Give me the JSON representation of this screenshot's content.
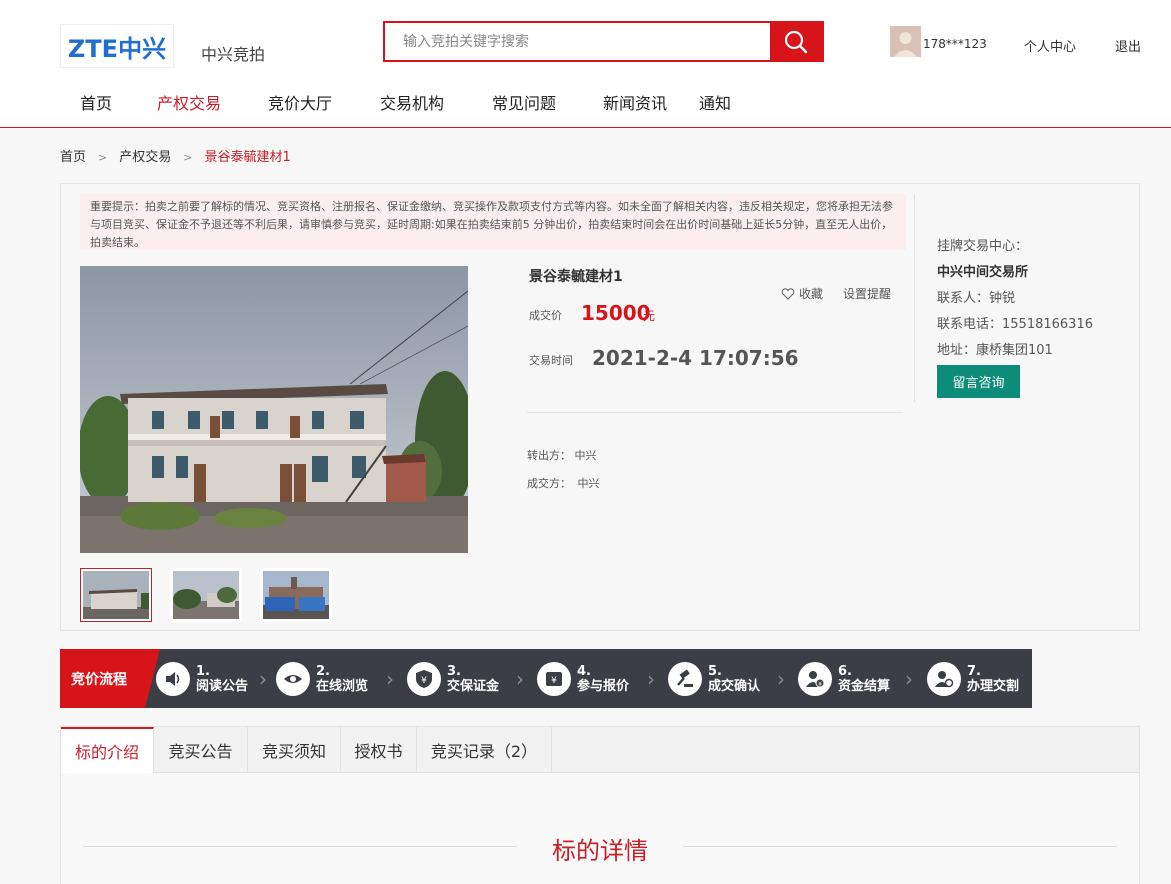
{
  "header": {
    "logo_text": "ZTE中兴",
    "site_name": "中兴竞拍",
    "search_placeholder": "输入竞拍关键字搜索",
    "username": "178***123",
    "personal_center": "个人中心",
    "logout": "退出"
  },
  "nav": {
    "items": [
      {
        "label": "首页"
      },
      {
        "label": "产权交易"
      },
      {
        "label": "竞价大厅"
      },
      {
        "label": "交易机构"
      },
      {
        "label": "常见问题"
      },
      {
        "label": "新闻资讯"
      },
      {
        "label": "通知"
      }
    ],
    "active_index": 1
  },
  "breadcrumb": {
    "items": [
      "首页",
      "产权交易",
      "景谷泰毓建材1"
    ],
    "separator": ">"
  },
  "notice": {
    "text": "重要提示：拍卖之前要了解标的情况、竞买资格、注册报名、保证金缴纳、竞买操作及款项支付方式等内容。如未全面了解相关内容，违反相关规定，您将承担无法参与项目竞买、保证金不予退还等不利后果，请审慎参与竞买，延时周期:如果在拍卖结束前5 分钟出价，拍卖结束时间会在出价时间基础上延长5分钟，直至无人出价，拍卖结束。"
  },
  "item": {
    "title": "景谷泰毓建材1",
    "favorite_label": "收藏",
    "reminder_label": "设置提醒",
    "price_label": "成交价",
    "price_value": "15000",
    "price_unit": "元",
    "time_label": "交易时间",
    "time_value": "2021-2-4 17:07:56",
    "seller_label": "转出方：",
    "seller_value": "中兴",
    "buyer_label": "成交方：",
    "buyer_value": "中兴"
  },
  "side": {
    "center_label": "挂牌交易中心：",
    "center_name": "中兴中间交易所",
    "contact": "联系人：钟锐",
    "phone": "联系电话：15518166316",
    "address": "地址：康桥集团101",
    "consult_button": "留言咨询"
  },
  "process": {
    "title": "竞价流程",
    "steps": [
      {
        "num": "1.",
        "label": "阅读公告",
        "icon": "speaker-icon"
      },
      {
        "num": "2.",
        "label": "在线浏览",
        "icon": "eye-icon"
      },
      {
        "num": "3.",
        "label": "交保证金",
        "icon": "shield-yuan-icon"
      },
      {
        "num": "4.",
        "label": "参与报价",
        "icon": "quote-icon"
      },
      {
        "num": "5.",
        "label": "成交确认",
        "icon": "gavel-icon"
      },
      {
        "num": "6.",
        "label": "资金结算",
        "icon": "user-yuan-icon"
      },
      {
        "num": "7.",
        "label": "办理交割",
        "icon": "user-refresh-icon"
      }
    ]
  },
  "tabs": {
    "items": [
      "标的介绍",
      "竞买公告",
      "竞买须知",
      "授权书",
      "竞买记录（2）"
    ],
    "active_index": 0
  },
  "detail": {
    "title": "标的详情"
  },
  "colors": {
    "brand_red": "#d8141b",
    "consult_green": "#0e8c7a",
    "process_bg": "#3b3e44",
    "logo_blue": "#1f6fd0"
  }
}
